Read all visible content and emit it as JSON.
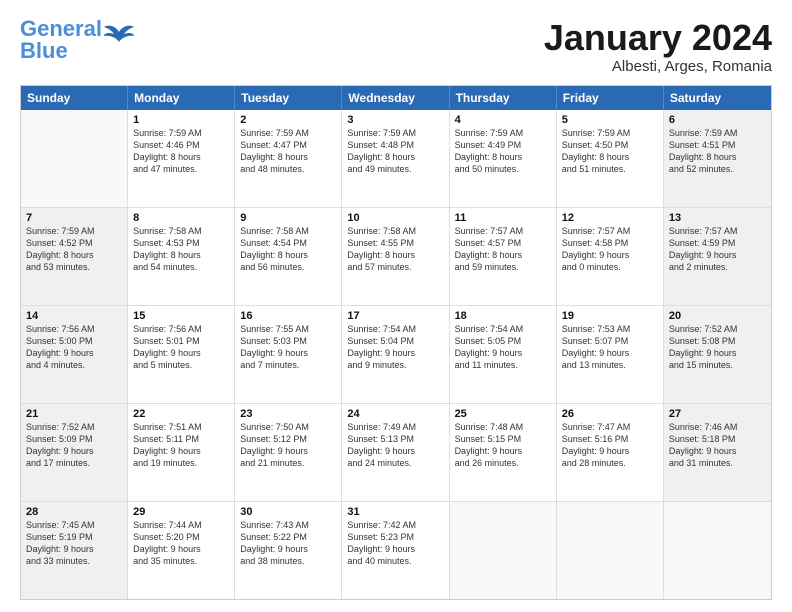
{
  "logo": {
    "line1": "General",
    "line2": "Blue"
  },
  "title": "January 2024",
  "subtitle": "Albesti, Arges, Romania",
  "header_days": [
    "Sunday",
    "Monday",
    "Tuesday",
    "Wednesday",
    "Thursday",
    "Friday",
    "Saturday"
  ],
  "weeks": [
    [
      {
        "day": "",
        "text": ""
      },
      {
        "day": "1",
        "text": "Sunrise: 7:59 AM\nSunset: 4:46 PM\nDaylight: 8 hours\nand 47 minutes."
      },
      {
        "day": "2",
        "text": "Sunrise: 7:59 AM\nSunset: 4:47 PM\nDaylight: 8 hours\nand 48 minutes."
      },
      {
        "day": "3",
        "text": "Sunrise: 7:59 AM\nSunset: 4:48 PM\nDaylight: 8 hours\nand 49 minutes."
      },
      {
        "day": "4",
        "text": "Sunrise: 7:59 AM\nSunset: 4:49 PM\nDaylight: 8 hours\nand 50 minutes."
      },
      {
        "day": "5",
        "text": "Sunrise: 7:59 AM\nSunset: 4:50 PM\nDaylight: 8 hours\nand 51 minutes."
      },
      {
        "day": "6",
        "text": "Sunrise: 7:59 AM\nSunset: 4:51 PM\nDaylight: 8 hours\nand 52 minutes."
      }
    ],
    [
      {
        "day": "7",
        "text": "Sunrise: 7:59 AM\nSunset: 4:52 PM\nDaylight: 8 hours\nand 53 minutes."
      },
      {
        "day": "8",
        "text": "Sunrise: 7:58 AM\nSunset: 4:53 PM\nDaylight: 8 hours\nand 54 minutes."
      },
      {
        "day": "9",
        "text": "Sunrise: 7:58 AM\nSunset: 4:54 PM\nDaylight: 8 hours\nand 56 minutes."
      },
      {
        "day": "10",
        "text": "Sunrise: 7:58 AM\nSunset: 4:55 PM\nDaylight: 8 hours\nand 57 minutes."
      },
      {
        "day": "11",
        "text": "Sunrise: 7:57 AM\nSunset: 4:57 PM\nDaylight: 8 hours\nand 59 minutes."
      },
      {
        "day": "12",
        "text": "Sunrise: 7:57 AM\nSunset: 4:58 PM\nDaylight: 9 hours\nand 0 minutes."
      },
      {
        "day": "13",
        "text": "Sunrise: 7:57 AM\nSunset: 4:59 PM\nDaylight: 9 hours\nand 2 minutes."
      }
    ],
    [
      {
        "day": "14",
        "text": "Sunrise: 7:56 AM\nSunset: 5:00 PM\nDaylight: 9 hours\nand 4 minutes."
      },
      {
        "day": "15",
        "text": "Sunrise: 7:56 AM\nSunset: 5:01 PM\nDaylight: 9 hours\nand 5 minutes."
      },
      {
        "day": "16",
        "text": "Sunrise: 7:55 AM\nSunset: 5:03 PM\nDaylight: 9 hours\nand 7 minutes."
      },
      {
        "day": "17",
        "text": "Sunrise: 7:54 AM\nSunset: 5:04 PM\nDaylight: 9 hours\nand 9 minutes."
      },
      {
        "day": "18",
        "text": "Sunrise: 7:54 AM\nSunset: 5:05 PM\nDaylight: 9 hours\nand 11 minutes."
      },
      {
        "day": "19",
        "text": "Sunrise: 7:53 AM\nSunset: 5:07 PM\nDaylight: 9 hours\nand 13 minutes."
      },
      {
        "day": "20",
        "text": "Sunrise: 7:52 AM\nSunset: 5:08 PM\nDaylight: 9 hours\nand 15 minutes."
      }
    ],
    [
      {
        "day": "21",
        "text": "Sunrise: 7:52 AM\nSunset: 5:09 PM\nDaylight: 9 hours\nand 17 minutes."
      },
      {
        "day": "22",
        "text": "Sunrise: 7:51 AM\nSunset: 5:11 PM\nDaylight: 9 hours\nand 19 minutes."
      },
      {
        "day": "23",
        "text": "Sunrise: 7:50 AM\nSunset: 5:12 PM\nDaylight: 9 hours\nand 21 minutes."
      },
      {
        "day": "24",
        "text": "Sunrise: 7:49 AM\nSunset: 5:13 PM\nDaylight: 9 hours\nand 24 minutes."
      },
      {
        "day": "25",
        "text": "Sunrise: 7:48 AM\nSunset: 5:15 PM\nDaylight: 9 hours\nand 26 minutes."
      },
      {
        "day": "26",
        "text": "Sunrise: 7:47 AM\nSunset: 5:16 PM\nDaylight: 9 hours\nand 28 minutes."
      },
      {
        "day": "27",
        "text": "Sunrise: 7:46 AM\nSunset: 5:18 PM\nDaylight: 9 hours\nand 31 minutes."
      }
    ],
    [
      {
        "day": "28",
        "text": "Sunrise: 7:45 AM\nSunset: 5:19 PM\nDaylight: 9 hours\nand 33 minutes."
      },
      {
        "day": "29",
        "text": "Sunrise: 7:44 AM\nSunset: 5:20 PM\nDaylight: 9 hours\nand 35 minutes."
      },
      {
        "day": "30",
        "text": "Sunrise: 7:43 AM\nSunset: 5:22 PM\nDaylight: 9 hours\nand 38 minutes."
      },
      {
        "day": "31",
        "text": "Sunrise: 7:42 AM\nSunset: 5:23 PM\nDaylight: 9 hours\nand 40 minutes."
      },
      {
        "day": "",
        "text": ""
      },
      {
        "day": "",
        "text": ""
      },
      {
        "day": "",
        "text": ""
      }
    ]
  ]
}
